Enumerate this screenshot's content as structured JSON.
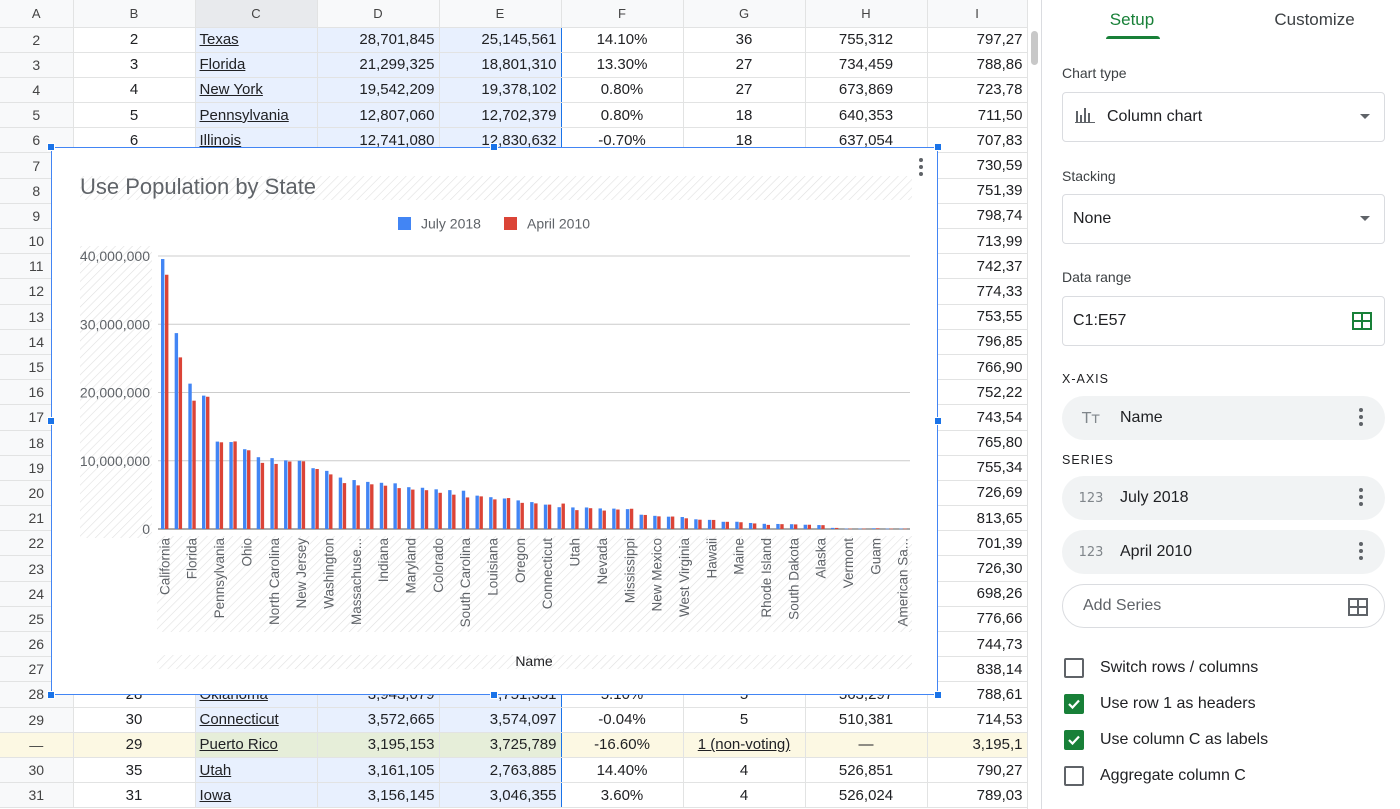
{
  "sheet": {
    "columns": [
      "A",
      "B",
      "C",
      "D",
      "E",
      "F",
      "G",
      "H",
      "I"
    ],
    "rows": [
      {
        "rownum": "2",
        "cells": [
          "2",
          "Texas",
          "28,701,845",
          "25,145,561",
          "14.10%",
          "36",
          "755,312",
          "797,27"
        ]
      },
      {
        "rownum": "3",
        "cells": [
          "3",
          "Florida",
          "21,299,325",
          "18,801,310",
          "13.30%",
          "27",
          "734,459",
          "788,86"
        ]
      },
      {
        "rownum": "4",
        "cells": [
          "4",
          "New York",
          "19,542,209",
          "19,378,102",
          "0.80%",
          "27",
          "673,869",
          "723,78"
        ]
      },
      {
        "rownum": "5",
        "cells": [
          "5",
          "Pennsylvania",
          "12,807,060",
          "12,702,379",
          "0.80%",
          "18",
          "640,353",
          "711,50"
        ]
      },
      {
        "rownum": "6",
        "cells": [
          "6",
          "Illinois",
          "12,741,080",
          "12,830,632",
          "-0.70%",
          "18",
          "637,054",
          "707,83"
        ]
      },
      {
        "rownum": "7",
        "cells": [
          "",
          "",
          "",
          "",
          "",
          "",
          "",
          "730,59"
        ]
      },
      {
        "rownum": "8",
        "cells": [
          "",
          "",
          "",
          "",
          "",
          "",
          "",
          "751,39"
        ]
      },
      {
        "rownum": "9",
        "cells": [
          "",
          "",
          "",
          "",
          "",
          "",
          "",
          "798,74"
        ]
      },
      {
        "rownum": "10",
        "cells": [
          "",
          "",
          "",
          "",
          "",
          "",
          "",
          "713,99"
        ]
      },
      {
        "rownum": "11",
        "cells": [
          "",
          "",
          "",
          "",
          "",
          "",
          "",
          "742,37"
        ]
      },
      {
        "rownum": "12",
        "cells": [
          "",
          "",
          "",
          "",
          "",
          "",
          "",
          "774,33"
        ]
      },
      {
        "rownum": "13",
        "cells": [
          "",
          "",
          "",
          "",
          "",
          "",
          "",
          "753,55"
        ]
      },
      {
        "rownum": "14",
        "cells": [
          "",
          "",
          "",
          "",
          "",
          "",
          "",
          "796,85"
        ]
      },
      {
        "rownum": "15",
        "cells": [
          "",
          "",
          "",
          "",
          "",
          "",
          "",
          "766,90"
        ]
      },
      {
        "rownum": "16",
        "cells": [
          "",
          "",
          "",
          "",
          "",
          "",
          "",
          "752,22"
        ]
      },
      {
        "rownum": "17",
        "cells": [
          "",
          "",
          "",
          "",
          "",
          "",
          "",
          "743,54"
        ]
      },
      {
        "rownum": "18",
        "cells": [
          "",
          "",
          "",
          "",
          "",
          "",
          "",
          "765,80"
        ]
      },
      {
        "rownum": "19",
        "cells": [
          "",
          "",
          "",
          "",
          "",
          "",
          "",
          "755,34"
        ]
      },
      {
        "rownum": "20",
        "cells": [
          "",
          "",
          "",
          "",
          "",
          "",
          "",
          "726,69"
        ]
      },
      {
        "rownum": "21",
        "cells": [
          "",
          "",
          "",
          "",
          "",
          "",
          "",
          "813,65"
        ]
      },
      {
        "rownum": "22",
        "cells": [
          "",
          "",
          "",
          "",
          "",
          "",
          "",
          "701,39"
        ]
      },
      {
        "rownum": "23",
        "cells": [
          "",
          "",
          "",
          "",
          "",
          "",
          "",
          "726,30"
        ]
      },
      {
        "rownum": "24",
        "cells": [
          "",
          "",
          "",
          "",
          "",
          "",
          "",
          "698,26"
        ]
      },
      {
        "rownum": "25",
        "cells": [
          "",
          "",
          "",
          "",
          "",
          "",
          "",
          "776,66"
        ]
      },
      {
        "rownum": "26",
        "cells": [
          "",
          "",
          "",
          "",
          "",
          "",
          "",
          "744,73"
        ]
      },
      {
        "rownum": "27",
        "cells": [
          "",
          "",
          "",
          "",
          "",
          "",
          "",
          "838,14"
        ]
      },
      {
        "rownum": "28",
        "cells": [
          "28",
          "Oklahoma",
          "3,943,079",
          "3,751,351",
          "5.10%",
          "5",
          "563,297",
          "788,61"
        ]
      },
      {
        "rownum": "29",
        "cells": [
          "30",
          "Connecticut",
          "3,572,665",
          "3,574,097",
          "-0.04%",
          "5",
          "510,381",
          "714,53"
        ]
      },
      {
        "rownum": "—",
        "cells": [
          "29",
          "Puerto Rico",
          "3,195,153",
          "3,725,789",
          "-16.60%",
          "1 (non-voting)",
          "—",
          "3,195,1"
        ],
        "highlight": true
      },
      {
        "rownum": "30",
        "cells": [
          "35",
          "Utah",
          "3,161,105",
          "2,763,885",
          "14.40%",
          "4",
          "526,851",
          "790,27"
        ]
      },
      {
        "rownum": "31",
        "cells": [
          "31",
          "Iowa",
          "3,156,145",
          "3,046,355",
          "3.60%",
          "4",
          "526,024",
          "789,03"
        ]
      }
    ]
  },
  "chart_data": {
    "type": "bar",
    "title": "Use Population by State",
    "xlabel": "Name",
    "ylabel": "",
    "ylim": [
      0,
      40000000
    ],
    "yticks": [
      "0",
      "10,000,000",
      "20,000,000",
      "30,000,000",
      "40,000,000"
    ],
    "legend_position": "top",
    "series": [
      {
        "name": "July 2018",
        "color": "#4285f4",
        "values": [
          39557045,
          28701845,
          21299325,
          19542209,
          12807060,
          12741080,
          11689442,
          10519475,
          10383620,
          10056044,
          9998915,
          8908520,
          8517685,
          7535591,
          7171646,
          6902149,
          6770010,
          6691878,
          6126452,
          6042718,
          5813568,
          5695564,
          5611179,
          4887871,
          4659978,
          4468402,
          4190713,
          3943079,
          3572665,
          3195153,
          3161105,
          3156145,
          3013825,
          2986530,
          2911505,
          2095428,
          1929268,
          1805832,
          1754208,
          1420491,
          1338404,
          1057315,
          1062305,
          882235,
          760077,
          737438,
          702455,
          626299,
          577737,
          165718,
          55465,
          53883,
          106977,
          51433,
          55000
        ]
      },
      {
        "name": "April 2010",
        "color": "#db4437",
        "values": [
          37253956,
          25145561,
          18801310,
          19378102,
          12702379,
          12830632,
          11536504,
          9687653,
          9535483,
          9883640,
          9920000,
          8791894,
          8001024,
          6724540,
          6392017,
          6547629,
          6346105,
          5988927,
          5773552,
          5686986,
          5303925,
          5029196,
          4625364,
          4779736,
          4339367,
          4533372,
          3831074,
          3751351,
          3574097,
          3725789,
          2763885,
          3046355,
          2700551,
          2853118,
          2967297,
          2059179,
          1852994,
          1826341,
          1567582,
          1360301,
          1328361,
          1052567,
          989415,
          814180,
          601723,
          710231,
          672591,
          625741,
          563626,
          159358,
          53883,
          53883,
          106405,
          53883,
          53883
        ]
      }
    ],
    "visible_category_labels": [
      "California",
      "Florida",
      "Pennsylvania",
      "Ohio",
      "North Carolina",
      "New Jersey",
      "Washington",
      "Massachuse...",
      "Indiana",
      "Maryland",
      "Colorado",
      "South Carolina",
      "Louisiana",
      "Oregon",
      "Connecticut",
      "Utah",
      "Nevada",
      "Mississippi",
      "New Mexico",
      "West Virginia",
      "Hawaii",
      "Maine",
      "Rhode Island",
      "South Dakota",
      "Alaska",
      "Vermont",
      "Guam",
      "American Sa..."
    ]
  },
  "panel": {
    "tabs": [
      "Setup",
      "Customize"
    ],
    "chart_type_label": "Chart type",
    "chart_type_value": "Column chart",
    "stacking_label": "Stacking",
    "stacking_value": "None",
    "data_range_label": "Data range",
    "data_range_value": "C1:E57",
    "xaxis_header": "X-AXIS",
    "xaxis_value": "Name",
    "series_header": "SERIES",
    "series": [
      "July 2018",
      "April 2010"
    ],
    "add_series": "Add Series",
    "text_type_icon": "Tт",
    "number_type_icon": "123",
    "checkboxes": [
      {
        "label": "Switch rows / columns",
        "checked": false
      },
      {
        "label": "Use row 1 as headers",
        "checked": true
      },
      {
        "label": "Use column C as labels",
        "checked": true
      },
      {
        "label": "Aggregate column C",
        "checked": false
      }
    ]
  }
}
